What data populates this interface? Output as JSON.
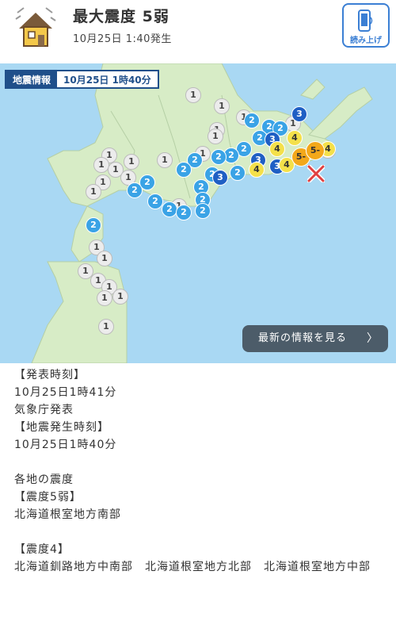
{
  "header": {
    "title": "最大震度 5弱",
    "subtitle": "10月25日 1:40発生",
    "read_button_label": "読み上げ"
  },
  "map": {
    "tag_label": "地震情報",
    "tag_datetime": "10月25日 1時40分",
    "latest_button_label": "最新の情報を見る",
    "intensity_marks": [
      "1",
      "2",
      "3",
      "4",
      "5-"
    ],
    "colors": {
      "sea": "#a9d8f3",
      "land": "#d7ecc6",
      "intensity_1": "#ececec",
      "intensity_2": "#3aa3e6",
      "intensity_3": "#1f5fc4",
      "intensity_4": "#f4e04a",
      "intensity_5_minus": "#f3a81a",
      "epicenter": "#e04040"
    }
  },
  "report": {
    "announce_time_heading": "【発表時刻】",
    "announce_time": "10月25日1時41分",
    "announcer": "気象庁発表",
    "occur_time_heading": "【地震発生時刻】",
    "occur_time": "10月25日1時40分",
    "regions_heading": "各地の震度",
    "int5_heading": "【震度5弱】",
    "int5_regions": "北海道根室地方南部",
    "int4_heading": "【震度4】",
    "int4_regions": "北海道釧路地方中南部　北海道根室地方北部　北海道根室地方中部"
  }
}
